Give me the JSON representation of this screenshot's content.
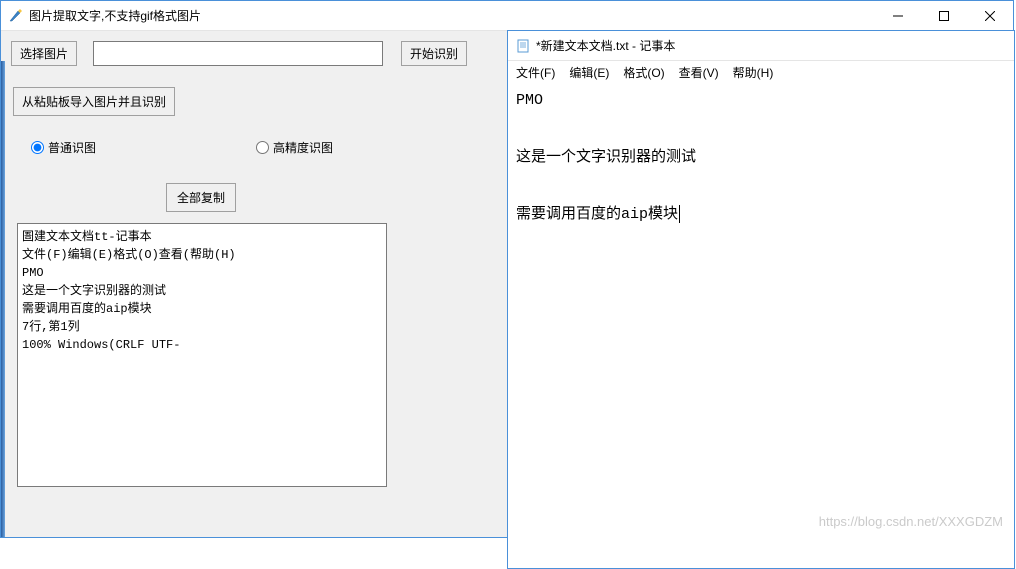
{
  "main": {
    "title": "图片提取文字,不支持gif格式图片",
    "select_image_btn": "选择图片",
    "path_value": "",
    "start_recognize_btn": "开始识别",
    "paste_recognize_btn": "从粘贴板导入图片并且识别",
    "radio_normal": "普通识图",
    "radio_high": "高精度识图",
    "copy_all_btn": "全部复制",
    "output_text": "圄建文本文档tt-记事本\n文件(F)编辑(E)格式(O)查看(帮助(H)\nPMO\n这是一个文字识别器的测试\n需要调用百度的aip模块\n7行,第1列\n100% Windows(CRLF UTF-"
  },
  "notepad": {
    "title": "*新建文本文档.txt - 记事本",
    "menu": {
      "file": "文件(F)",
      "edit": "编辑(E)",
      "format": "格式(O)",
      "view": "查看(V)",
      "help": "帮助(H)"
    },
    "content": "PMO\n\n这是一个文字识别器的测试\n\n需要调用百度的aip模块"
  },
  "watermark": "https://blog.csdn.net/XXXGDZM"
}
